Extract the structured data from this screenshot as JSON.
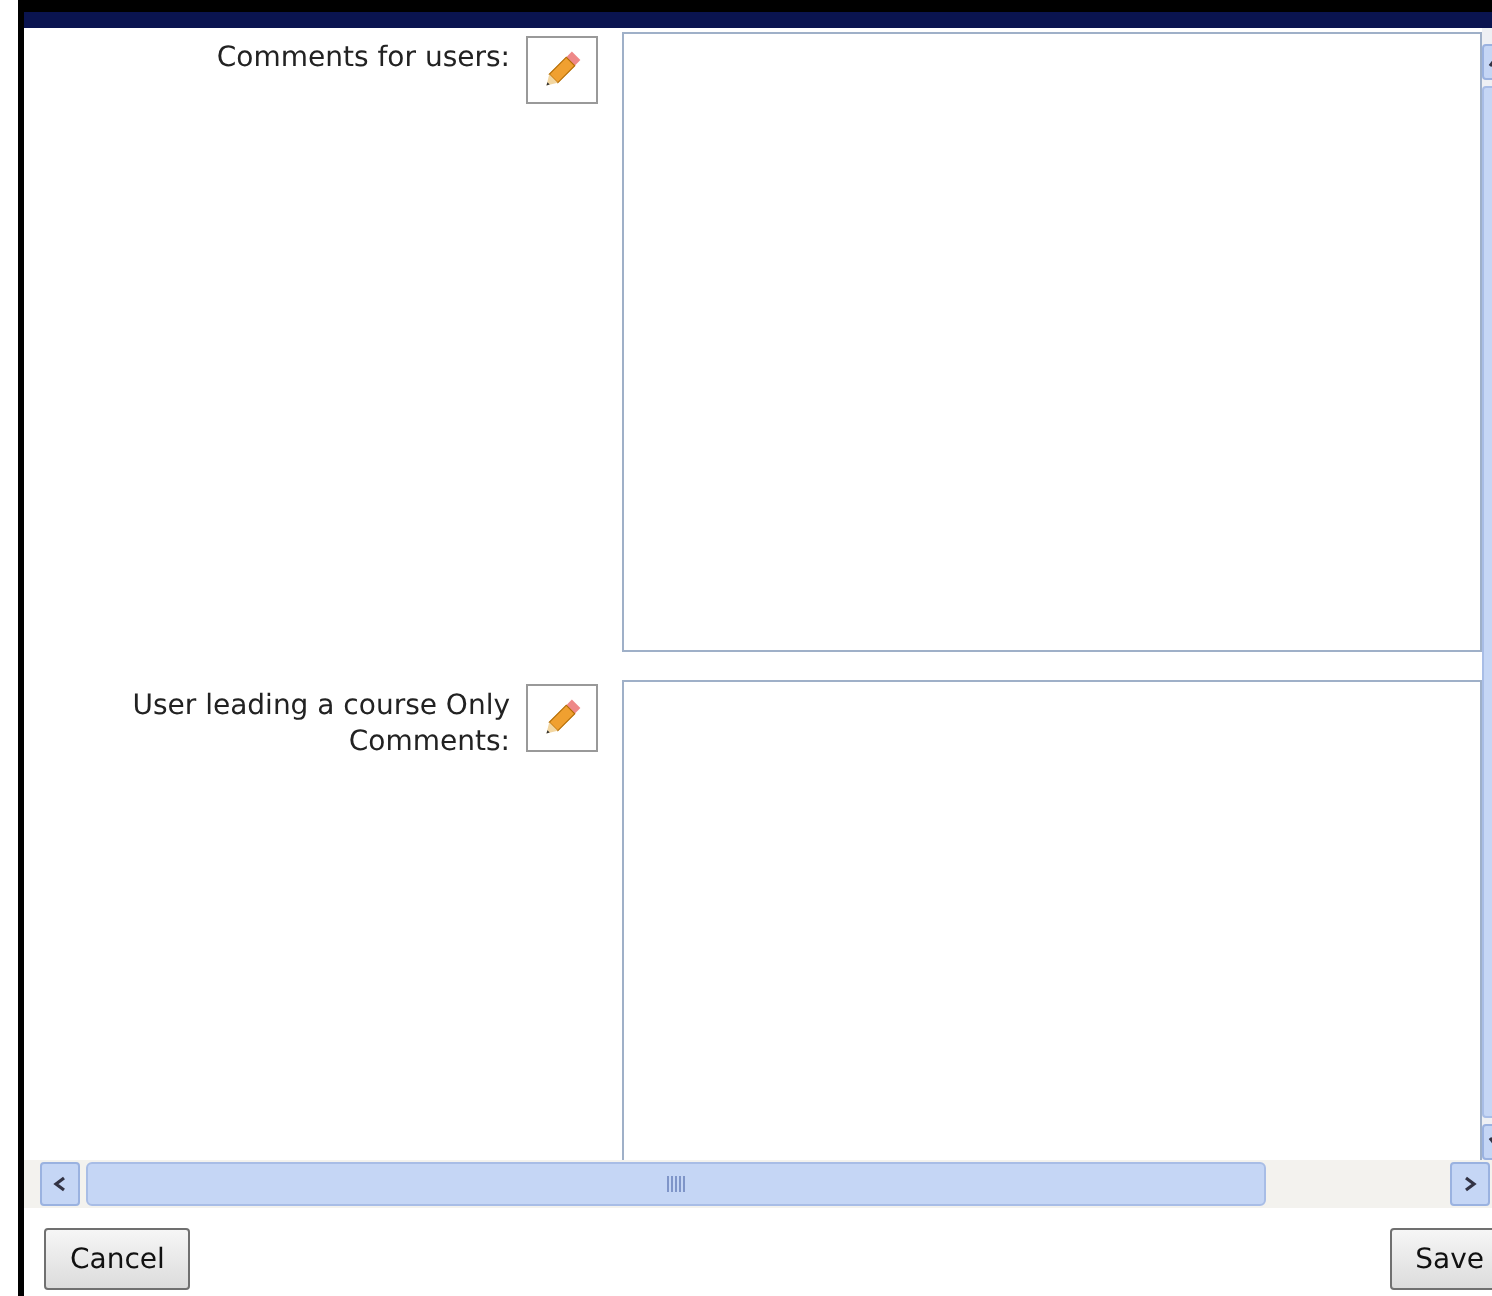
{
  "fields": [
    {
      "label": "Comments for users:"
    },
    {
      "label": "User leading a course Only Comments:"
    }
  ],
  "buttons": [
    "Cancel",
    "Save"
  ]
}
